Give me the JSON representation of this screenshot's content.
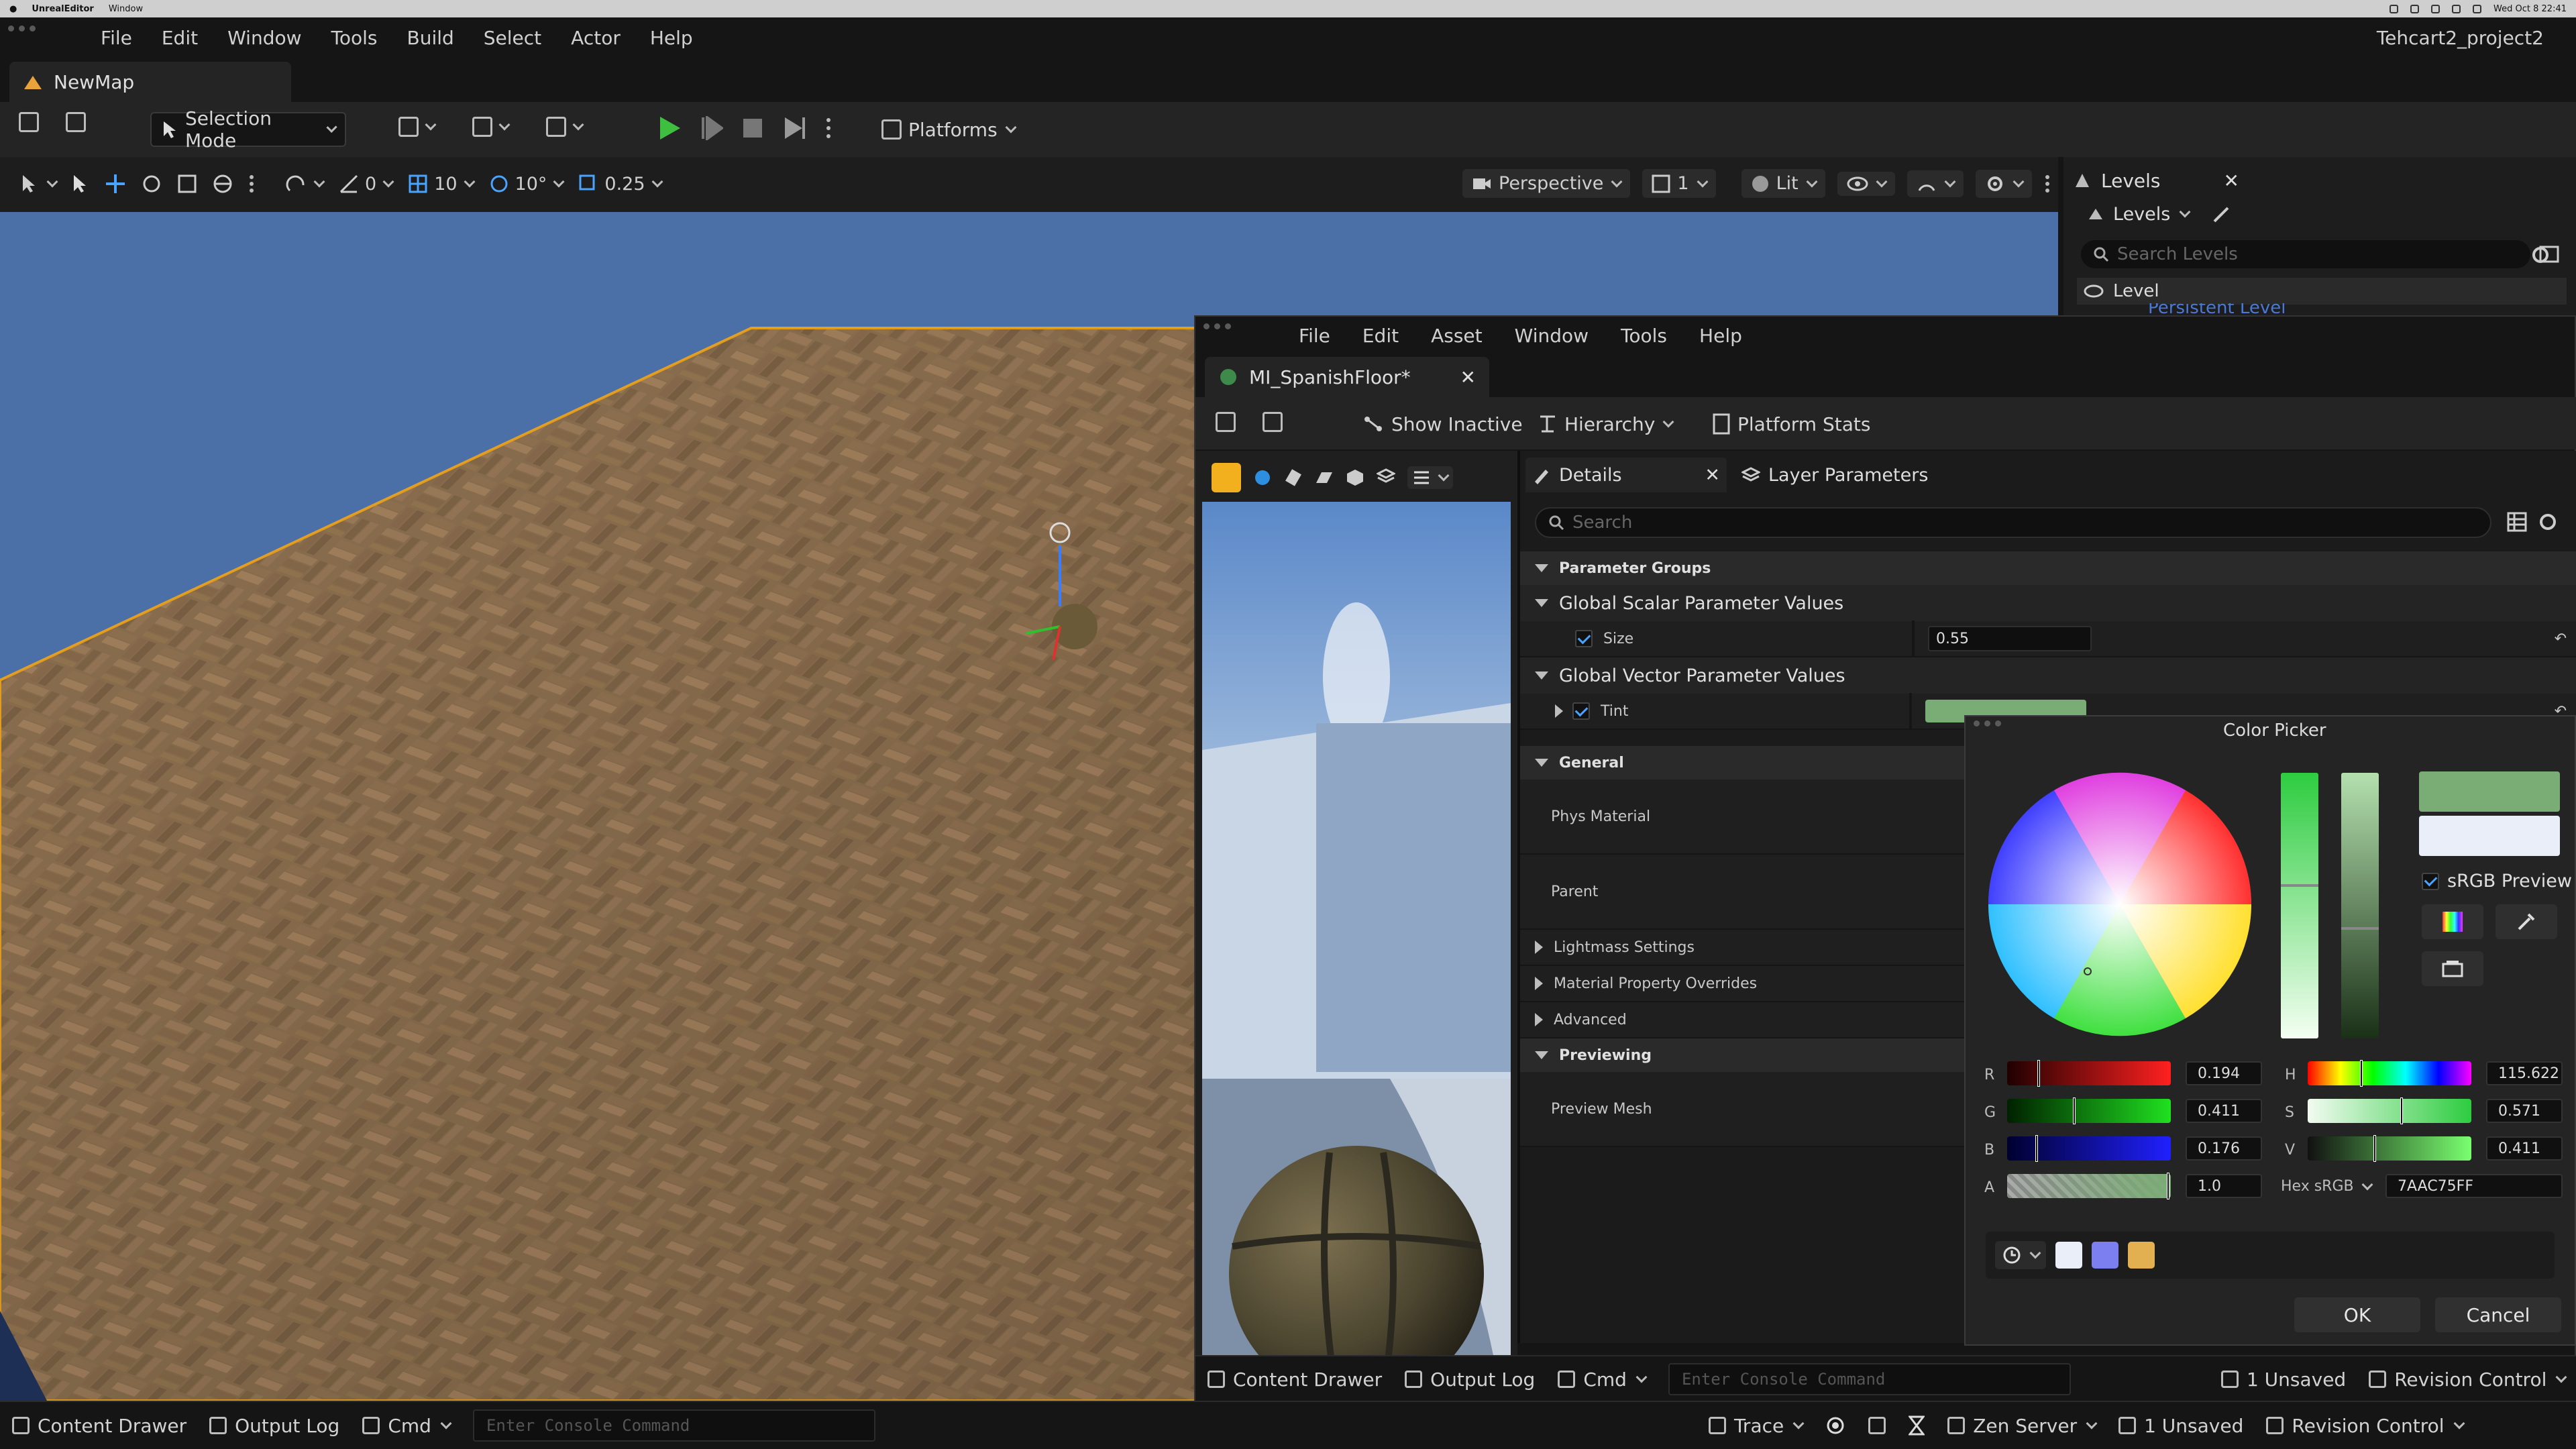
{
  "os_bar": {
    "app": "UnrealEditor",
    "menu": "Window",
    "datetime": "Wed Oct 8 22:41"
  },
  "menubar": {
    "items": [
      "File",
      "Edit",
      "Window",
      "Tools",
      "Build",
      "Select",
      "Actor",
      "Help"
    ],
    "project": "Tehcart2_project2"
  },
  "map_tab": {
    "label": "NewMap"
  },
  "toolbar": {
    "selection_mode": "Selection Mode",
    "platforms": "Platforms"
  },
  "viewport": {
    "rotation": "0",
    "grid": "10",
    "angle": "10°",
    "scale": "0.25",
    "view_mode": "Perspective",
    "camera_speed": "1",
    "lighting": "Lit",
    "sky_color": "#4b70a8",
    "floor_color": "#8a6e4e"
  },
  "levels": {
    "tab": "Levels",
    "dropdown": "Levels",
    "search_placeholder": "Search Levels",
    "header": "Level",
    "persistent": "Persistent Level"
  },
  "material_editor": {
    "menu": [
      "File",
      "Edit",
      "Asset",
      "Window",
      "Tools",
      "Help"
    ],
    "tab": "MI_SpanishFloor*",
    "toolbar": {
      "show_inactive": "Show Inactive",
      "hierarchy": "Hierarchy",
      "platform_stats": "Platform Stats"
    },
    "details_tab": "Details",
    "layer_tab": "Layer Parameters",
    "search_placeholder": "Search",
    "sections": {
      "parameter_groups": "Parameter Groups",
      "scalar": "Global Scalar Parameter Values",
      "size_label": "Size",
      "size_value": "0.55",
      "vector": "Global Vector Parameter Values",
      "tint_label": "Tint",
      "general": "General",
      "phys_material": "Phys Material",
      "parent": "Parent",
      "lightmass": "Lightmass Settings",
      "overrides": "Material Property Overrides",
      "advanced": "Advanced",
      "previewing": "Previewing",
      "preview_mesh": "Preview Mesh"
    },
    "bottom": {
      "content_drawer": "Content Drawer",
      "output_log": "Output Log",
      "cmd": "Cmd",
      "console_placeholder": "Enter Console Command",
      "unsaved": "1 Unsaved",
      "revision": "Revision Control"
    }
  },
  "color_picker": {
    "title": "Color Picker",
    "srgb_preview": "sRGB Preview",
    "r": "0.194",
    "g": "0.411",
    "b": "0.176",
    "a": "1.0",
    "h": "115.622",
    "s": "0.571",
    "v": "0.411",
    "hex_label": "Hex sRGB",
    "hex": "7AAC75FF",
    "current_color": "#7aac75",
    "old_color": "#e9eef8",
    "recent_colors": [
      "#e9eef8",
      "#7b7ff0",
      "#e2b050"
    ],
    "ok": "OK",
    "cancel": "Cancel"
  },
  "status_bar": {
    "content_drawer": "Content Drawer",
    "output_log": "Output Log",
    "cmd": "Cmd",
    "console_placeholder": "Enter Console Command",
    "trace": "Trace",
    "zen": "Zen Server",
    "unsaved": "1 Unsaved",
    "revision": "Revision Control"
  }
}
